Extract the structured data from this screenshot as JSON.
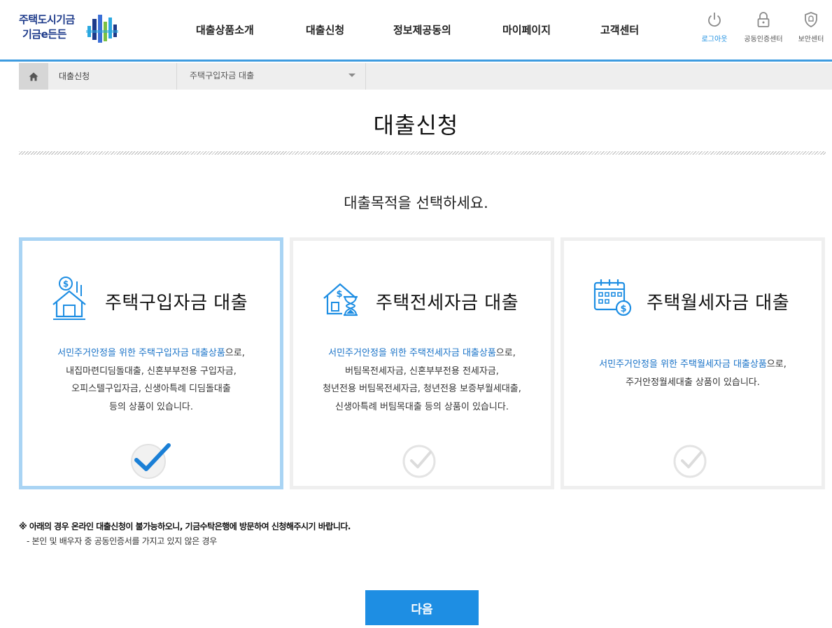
{
  "header": {
    "logo_line1": "주택도시기금",
    "logo_line2": "기금e든든",
    "nav": [
      {
        "label": "대출상품소개"
      },
      {
        "label": "대출신청"
      },
      {
        "label": "정보제공동의"
      },
      {
        "label": "마이페이지"
      },
      {
        "label": "고객센터"
      }
    ],
    "util": [
      {
        "label": "로그아웃",
        "icon": "power-icon"
      },
      {
        "label": "공동인증센터",
        "icon": "lock-icon"
      },
      {
        "label": "보안센터",
        "icon": "shield-icon"
      }
    ]
  },
  "breadcrumb": {
    "home_icon": "home-icon",
    "level1": "대출신청",
    "level2": "주택구입자금 대출"
  },
  "page": {
    "title": "대출신청",
    "subtitle": "대출목적을 선택하세요."
  },
  "cards": [
    {
      "title": "주택구입자금 대출",
      "icon": "house-dollar-icon",
      "selected": true,
      "highlight": "서민주거안정을 위한 주택구입자금 대출상품",
      "highlight_suffix": "으로,",
      "lines": [
        "내집마련디딤돌대출, 신혼부부전용 구입자금,",
        "오피스텔구입자금, 신생아특례 디딤돌대출",
        "등의 상품이 있습니다."
      ]
    },
    {
      "title": "주택전세자금 대출",
      "icon": "house-hourglass-icon",
      "selected": false,
      "highlight": "서민주거안정을 위한 주택전세자금 대출상품",
      "highlight_suffix": "으로,",
      "lines": [
        "버팀목전세자금, 신혼부부전용 전세자금,",
        "청년전용 버팀목전세자금, 청년전용 보증부월세대출,",
        "신생아특례 버팀목대출 등의 상품이 있습니다."
      ]
    },
    {
      "title": "주택월세자금 대출",
      "icon": "calendar-dollar-icon",
      "selected": false,
      "highlight": "서민주거안정을 위한 주택월세자금 대출상품",
      "highlight_suffix": "으로,",
      "lines": [
        "주거안정월세대출 상품이 있습니다."
      ]
    }
  ],
  "notice": {
    "main": "※ 아래의 경우 온라인 대출신청이 불가능하오니, 기금수탁은행에 방문하여 신청해주시기 바랍니다.",
    "sub": "- 본인 및 배우자 중 공동인증서를 가지고 있지 않은 경우"
  },
  "next_button": "다음",
  "colors": {
    "accent": "#1e8ee3",
    "header_line": "#3e9ce0",
    "selected_border": "#a9d4f4",
    "highlight_text": "#1a73c8",
    "check_active": "#1a7fd6",
    "check_inactive": "#dddddd"
  }
}
